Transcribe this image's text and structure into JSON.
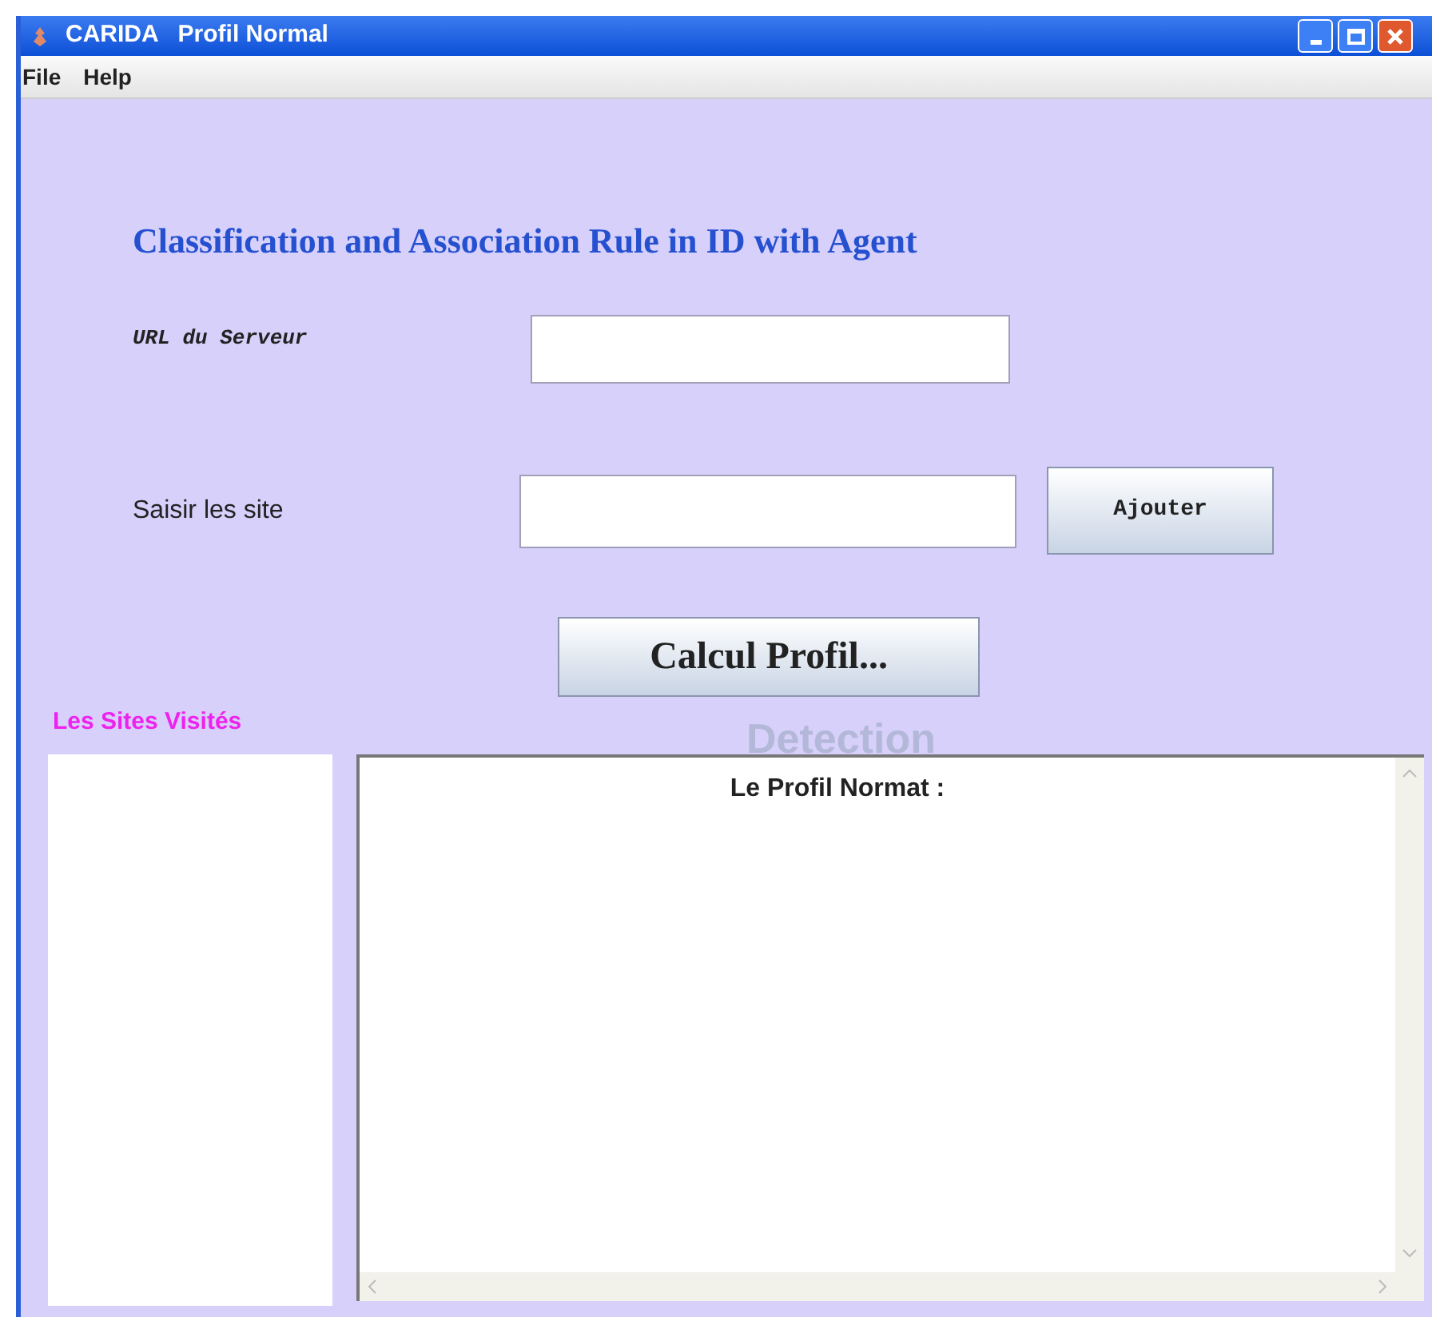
{
  "window": {
    "title": "CARIDA   Profil Normal"
  },
  "menu": [
    "File",
    "Help"
  ],
  "heading": "Classification and Association Rule in ID with Agent",
  "server_url": {
    "label": "URL du Serveur"
  },
  "site_input": {
    "label": "Saisir les site"
  },
  "add_button": "Ajouter",
  "compute_button": "Calcul Profil...",
  "visited_sites": {
    "label": "Les Sites Visités"
  },
  "detection_label": "Detection",
  "profile_area": {
    "text": "Le Profil Normat :"
  }
}
